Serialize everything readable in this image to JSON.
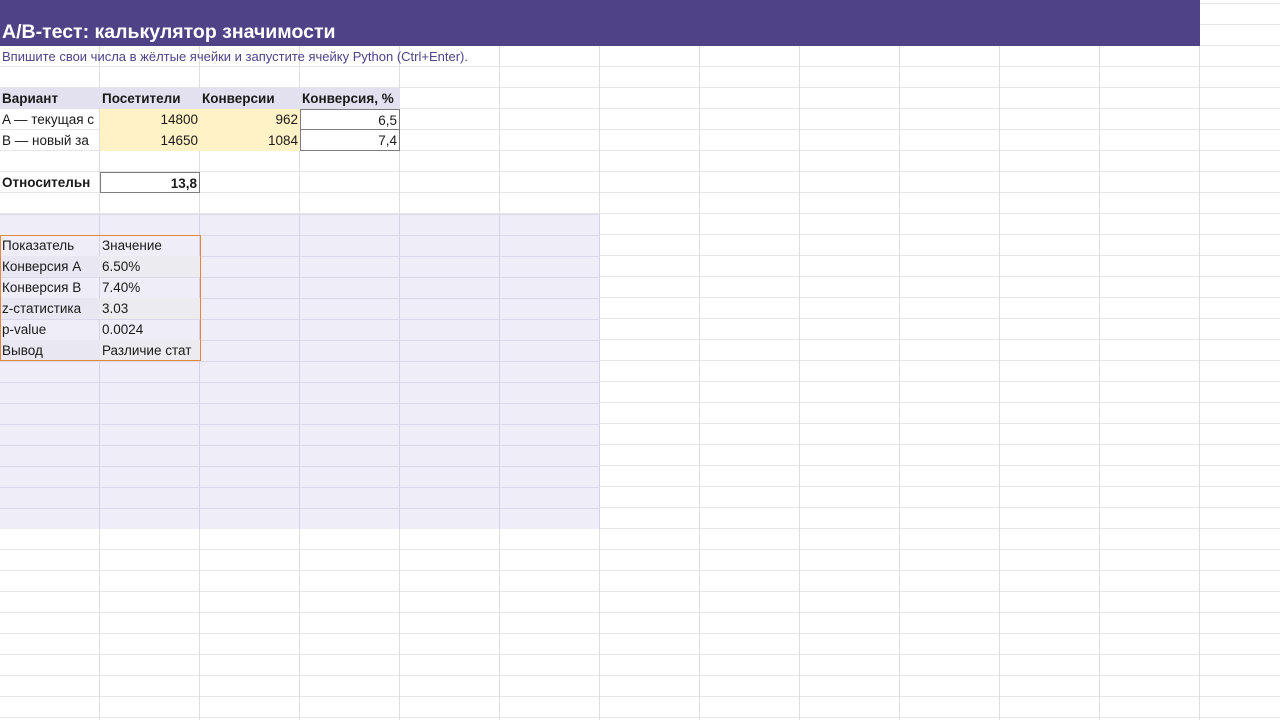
{
  "sheet": {
    "title": "A/B-тест: калькулятор значимости",
    "subtitle": "Впишите свои числа в жёлтые ячейки и запустите ячейку Python (Ctrl+Enter)."
  },
  "input_table": {
    "headers": [
      "Вариант",
      "Посетители",
      "Конверсии",
      "Конверсия, %"
    ],
    "rows": [
      {
        "variant": "A — текущая с",
        "visitors": "14800",
        "conversions": "962",
        "rate": "6,5"
      },
      {
        "variant": "B — новый за",
        "visitors": "14650",
        "conversions": "1084",
        "rate": "7,4"
      }
    ]
  },
  "relative": {
    "label": "Относительн",
    "value": "13,8"
  },
  "results": {
    "headers": [
      "Показатель",
      "Значение"
    ],
    "rows": [
      {
        "metric": "Конверсия A",
        "value": "6.50%"
      },
      {
        "metric": "Конверсия B",
        "value": "7.40%"
      },
      {
        "metric": "z-статистика",
        "value": "3.03"
      },
      {
        "metric": "p-value",
        "value": "0.0024"
      },
      {
        "metric": "Вывод",
        "value": "Различие стат"
      }
    ]
  },
  "colors": {
    "title_bg": "#4f4287",
    "header_bg": "#e3e0f0",
    "input_cell_bg": "#fff2c6",
    "python_output_bg": "#efedf7",
    "output_border": "#e08a3c"
  }
}
